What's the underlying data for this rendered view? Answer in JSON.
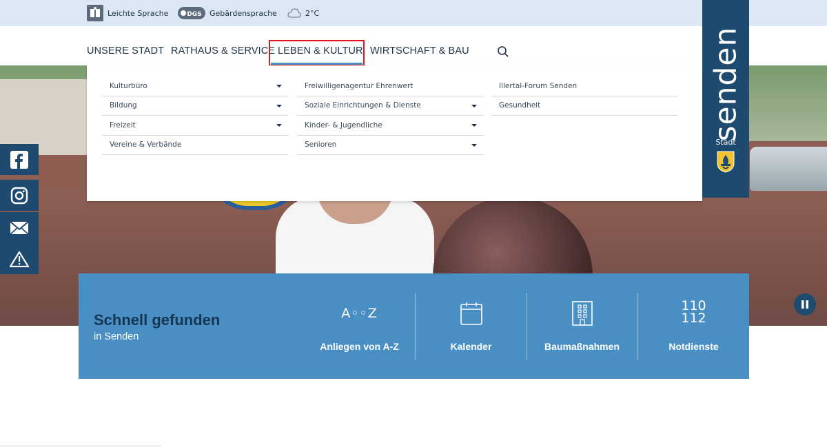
{
  "utility": {
    "easy_language": "Leichte Sprache",
    "sign_language_badge": "DGS",
    "sign_language": "Gebärdensprache",
    "weather": "2°C"
  },
  "nav": {
    "items": [
      "UNSERE STADT",
      "RATHAUS & SERVICE",
      "LEBEN & KULTUR",
      "WIRTSCHAFT & BAU"
    ],
    "active": "LEBEN & KULTUR",
    "search_icon": "search-icon"
  },
  "brand": {
    "name": "senden",
    "subtitle": "Stadt"
  },
  "mega_menu": {
    "col1": [
      {
        "label": "Kulturbüro",
        "has_submenu": true
      },
      {
        "label": "Bildung",
        "has_submenu": true
      },
      {
        "label": "Freizeit",
        "has_submenu": true
      },
      {
        "label": "Vereine & Verbände",
        "has_submenu": false
      }
    ],
    "col2": [
      {
        "label": "Freiwilligenagentur Ehrenwert",
        "has_submenu": false
      },
      {
        "label": "Soziale Einrichtungen & Dienste",
        "has_submenu": true
      },
      {
        "label": "Kinder- & Jugendliche",
        "has_submenu": true
      },
      {
        "label": "Senioren",
        "has_submenu": true
      }
    ],
    "col3": [
      {
        "label": "Illertal-Forum Senden",
        "has_submenu": false
      },
      {
        "label": "Gesundheit",
        "has_submenu": false
      }
    ]
  },
  "social": [
    "facebook-icon",
    "instagram-icon",
    "mail-icon",
    "warning-icon"
  ],
  "quick": {
    "title": "Schnell gefunden",
    "subtitle": "in Senden",
    "tiles": [
      {
        "label": "Anliegen von A-Z",
        "icon_text": "A◦◦Z"
      },
      {
        "label": "Kalender",
        "icon_text": ""
      },
      {
        "label": "Baumaßnahmen",
        "icon_text": ""
      },
      {
        "label": "Notdienste",
        "icon_line1": "110",
        "icon_line2": "112"
      }
    ]
  },
  "colors": {
    "topbar": "#dbe7f2",
    "brand_blue": "#1f4a6f",
    "quick_blue": "#4a8fc4",
    "active_outline": "#e3141c"
  }
}
